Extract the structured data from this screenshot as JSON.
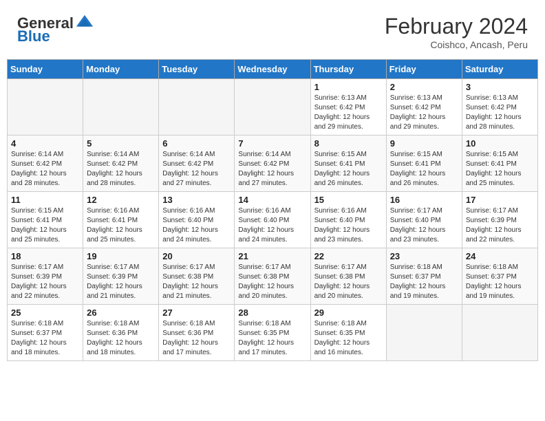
{
  "logo": {
    "general": "General",
    "blue": "Blue"
  },
  "title": "February 2024",
  "subtitle": "Coishco, Ancash, Peru",
  "days": [
    "Sunday",
    "Monday",
    "Tuesday",
    "Wednesday",
    "Thursday",
    "Friday",
    "Saturday"
  ],
  "weeks": [
    [
      {
        "day": "",
        "content": ""
      },
      {
        "day": "",
        "content": ""
      },
      {
        "day": "",
        "content": ""
      },
      {
        "day": "",
        "content": ""
      },
      {
        "day": "1",
        "content": "Sunrise: 6:13 AM\nSunset: 6:42 PM\nDaylight: 12 hours\nand 29 minutes."
      },
      {
        "day": "2",
        "content": "Sunrise: 6:13 AM\nSunset: 6:42 PM\nDaylight: 12 hours\nand 29 minutes."
      },
      {
        "day": "3",
        "content": "Sunrise: 6:13 AM\nSunset: 6:42 PM\nDaylight: 12 hours\nand 28 minutes."
      }
    ],
    [
      {
        "day": "4",
        "content": "Sunrise: 6:14 AM\nSunset: 6:42 PM\nDaylight: 12 hours\nand 28 minutes."
      },
      {
        "day": "5",
        "content": "Sunrise: 6:14 AM\nSunset: 6:42 PM\nDaylight: 12 hours\nand 28 minutes."
      },
      {
        "day": "6",
        "content": "Sunrise: 6:14 AM\nSunset: 6:42 PM\nDaylight: 12 hours\nand 27 minutes."
      },
      {
        "day": "7",
        "content": "Sunrise: 6:14 AM\nSunset: 6:42 PM\nDaylight: 12 hours\nand 27 minutes."
      },
      {
        "day": "8",
        "content": "Sunrise: 6:15 AM\nSunset: 6:41 PM\nDaylight: 12 hours\nand 26 minutes."
      },
      {
        "day": "9",
        "content": "Sunrise: 6:15 AM\nSunset: 6:41 PM\nDaylight: 12 hours\nand 26 minutes."
      },
      {
        "day": "10",
        "content": "Sunrise: 6:15 AM\nSunset: 6:41 PM\nDaylight: 12 hours\nand 25 minutes."
      }
    ],
    [
      {
        "day": "11",
        "content": "Sunrise: 6:15 AM\nSunset: 6:41 PM\nDaylight: 12 hours\nand 25 minutes."
      },
      {
        "day": "12",
        "content": "Sunrise: 6:16 AM\nSunset: 6:41 PM\nDaylight: 12 hours\nand 25 minutes."
      },
      {
        "day": "13",
        "content": "Sunrise: 6:16 AM\nSunset: 6:40 PM\nDaylight: 12 hours\nand 24 minutes."
      },
      {
        "day": "14",
        "content": "Sunrise: 6:16 AM\nSunset: 6:40 PM\nDaylight: 12 hours\nand 24 minutes."
      },
      {
        "day": "15",
        "content": "Sunrise: 6:16 AM\nSunset: 6:40 PM\nDaylight: 12 hours\nand 23 minutes."
      },
      {
        "day": "16",
        "content": "Sunrise: 6:17 AM\nSunset: 6:40 PM\nDaylight: 12 hours\nand 23 minutes."
      },
      {
        "day": "17",
        "content": "Sunrise: 6:17 AM\nSunset: 6:39 PM\nDaylight: 12 hours\nand 22 minutes."
      }
    ],
    [
      {
        "day": "18",
        "content": "Sunrise: 6:17 AM\nSunset: 6:39 PM\nDaylight: 12 hours\nand 22 minutes."
      },
      {
        "day": "19",
        "content": "Sunrise: 6:17 AM\nSunset: 6:39 PM\nDaylight: 12 hours\nand 21 minutes."
      },
      {
        "day": "20",
        "content": "Sunrise: 6:17 AM\nSunset: 6:38 PM\nDaylight: 12 hours\nand 21 minutes."
      },
      {
        "day": "21",
        "content": "Sunrise: 6:17 AM\nSunset: 6:38 PM\nDaylight: 12 hours\nand 20 minutes."
      },
      {
        "day": "22",
        "content": "Sunrise: 6:17 AM\nSunset: 6:38 PM\nDaylight: 12 hours\nand 20 minutes."
      },
      {
        "day": "23",
        "content": "Sunrise: 6:18 AM\nSunset: 6:37 PM\nDaylight: 12 hours\nand 19 minutes."
      },
      {
        "day": "24",
        "content": "Sunrise: 6:18 AM\nSunset: 6:37 PM\nDaylight: 12 hours\nand 19 minutes."
      }
    ],
    [
      {
        "day": "25",
        "content": "Sunrise: 6:18 AM\nSunset: 6:37 PM\nDaylight: 12 hours\nand 18 minutes."
      },
      {
        "day": "26",
        "content": "Sunrise: 6:18 AM\nSunset: 6:36 PM\nDaylight: 12 hours\nand 18 minutes."
      },
      {
        "day": "27",
        "content": "Sunrise: 6:18 AM\nSunset: 6:36 PM\nDaylight: 12 hours\nand 17 minutes."
      },
      {
        "day": "28",
        "content": "Sunrise: 6:18 AM\nSunset: 6:35 PM\nDaylight: 12 hours\nand 17 minutes."
      },
      {
        "day": "29",
        "content": "Sunrise: 6:18 AM\nSunset: 6:35 PM\nDaylight: 12 hours\nand 16 minutes."
      },
      {
        "day": "",
        "content": ""
      },
      {
        "day": "",
        "content": ""
      }
    ]
  ]
}
